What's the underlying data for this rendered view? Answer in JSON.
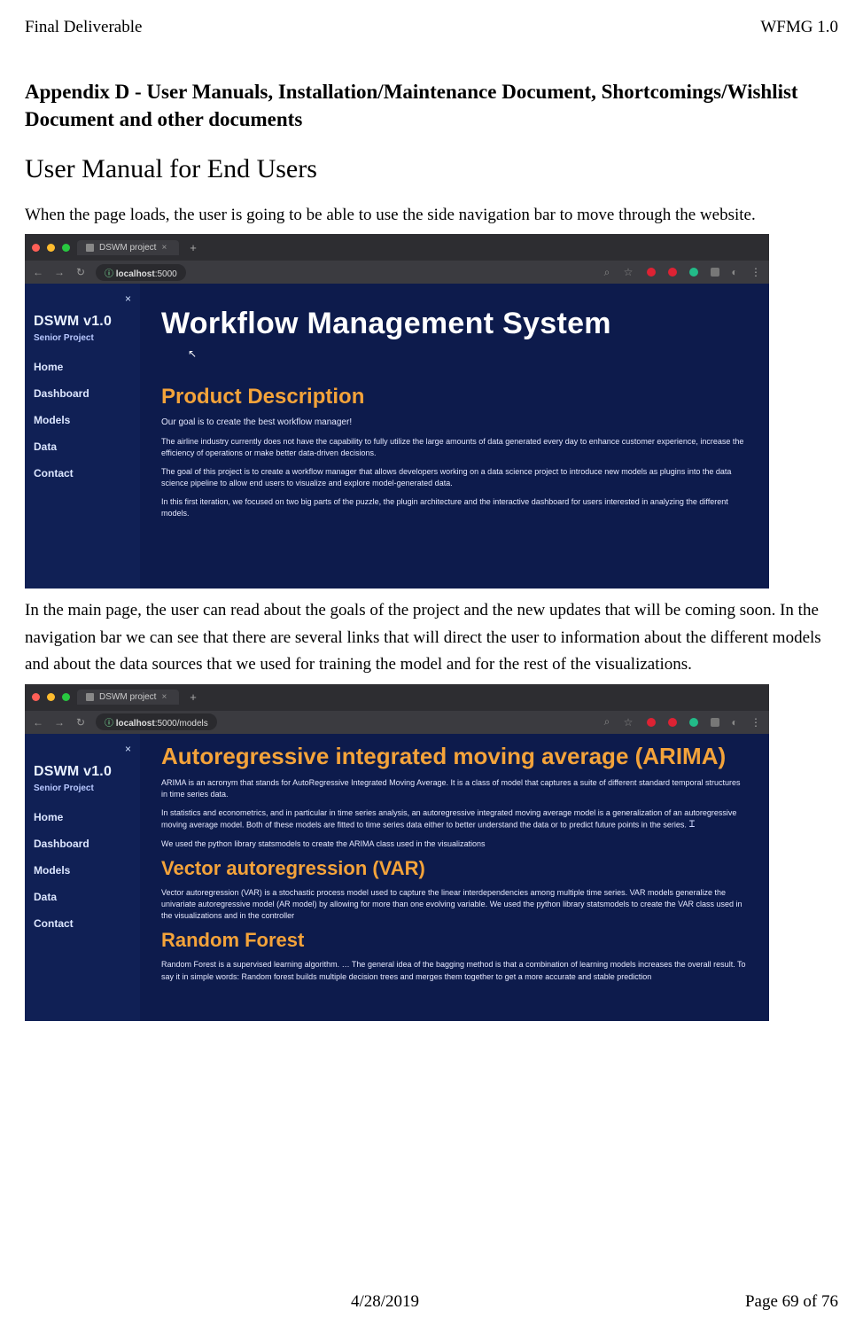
{
  "header": {
    "left": "Final Deliverable",
    "right": "WFMG 1.0"
  },
  "footer": {
    "center": "4/28/2019",
    "right": "Page 69 of 76"
  },
  "appendix_heading": "Appendix D - User Manuals, Installation/Maintenance Document, Shortcomings/Wishlist Document and other documents",
  "section_heading": "User Manual for End Users",
  "para1": "When the page loads, the user is going to be able to use the side navigation bar to move through the website.",
  "para2": "In the main page, the user can read about the goals of the project and the new updates that will be coming soon. In the navigation bar we can see that there are several links that will direct the user to information about the different models and about the data sources that we used for training the model and for the rest of the visualizations.",
  "traffic": {
    "red": "#ff5f57",
    "yellow": "#febc2e",
    "green": "#28c840"
  },
  "shot_common": {
    "tab_title": "DSWM project",
    "sidebar": {
      "close": "×",
      "title": "DSWM v1.0",
      "subtitle": "Senior Project",
      "items": [
        "Home",
        "Dashboard",
        "Models",
        "Data",
        "Contact"
      ]
    }
  },
  "shot1": {
    "url_host": "localhost",
    "url_port": ":5000",
    "hero": "Workflow Management System",
    "h2": "Product Description",
    "lead": "Our goal is to create the best workflow manager!",
    "p1": "The airline industry currently does not have the capability to fully utilize the large amounts of data generated every day to enhance customer experience, increase the efficiency of operations or make better data-driven decisions.",
    "p2": "The goal of this project is to create a workflow manager that allows developers working on a data science project to introduce new models as plugins into the data science pipeline to allow end users to visualize and explore model-generated data.",
    "p3": "In this first iteration, we focused on two big parts of the puzzle, the plugin architecture and the interactive dashboard for users interested in analyzing the different models."
  },
  "shot2": {
    "url_host": "localhost",
    "url_path": ":5000/models",
    "h_arima": "Autoregressive integrated moving average (ARIMA)",
    "arima_p1": "ARIMA is an acronym that stands for AutoRegressive Integrated Moving Average. It is a class of model that captures a suite of different standard temporal structures in time series data.",
    "arima_p2a": "In statistics and econometrics, and in particular in time series analysis, an autoregressive integrated moving average model is a generalization of an autoregressive moving average model. Both of these models are fitted to time series data either to better understand the data or to predict future points in the series.",
    "arima_p2b": "",
    "arima_p3": "We used the python library statsmodels to create the ARIMA class used in the visualizations",
    "h_var": "Vector autoregression (VAR)",
    "var_p1": "Vector autoregression (VAR) is a stochastic process model used to capture the linear interdependencies among multiple time series. VAR models generalize the univariate autoregressive model (AR model) by allowing for more than one evolving variable. We used the python library statsmodels to create the VAR class used in the visualizations and in the controller",
    "h_rf": "Random Forest",
    "rf_p1": "Random Forest is a supervised learning algorithm. … The general idea of the bagging method is that a combination of learning models increases the overall result. To say it in simple words: Random forest builds multiple decision trees and merges them together to get a more accurate and stable prediction"
  }
}
